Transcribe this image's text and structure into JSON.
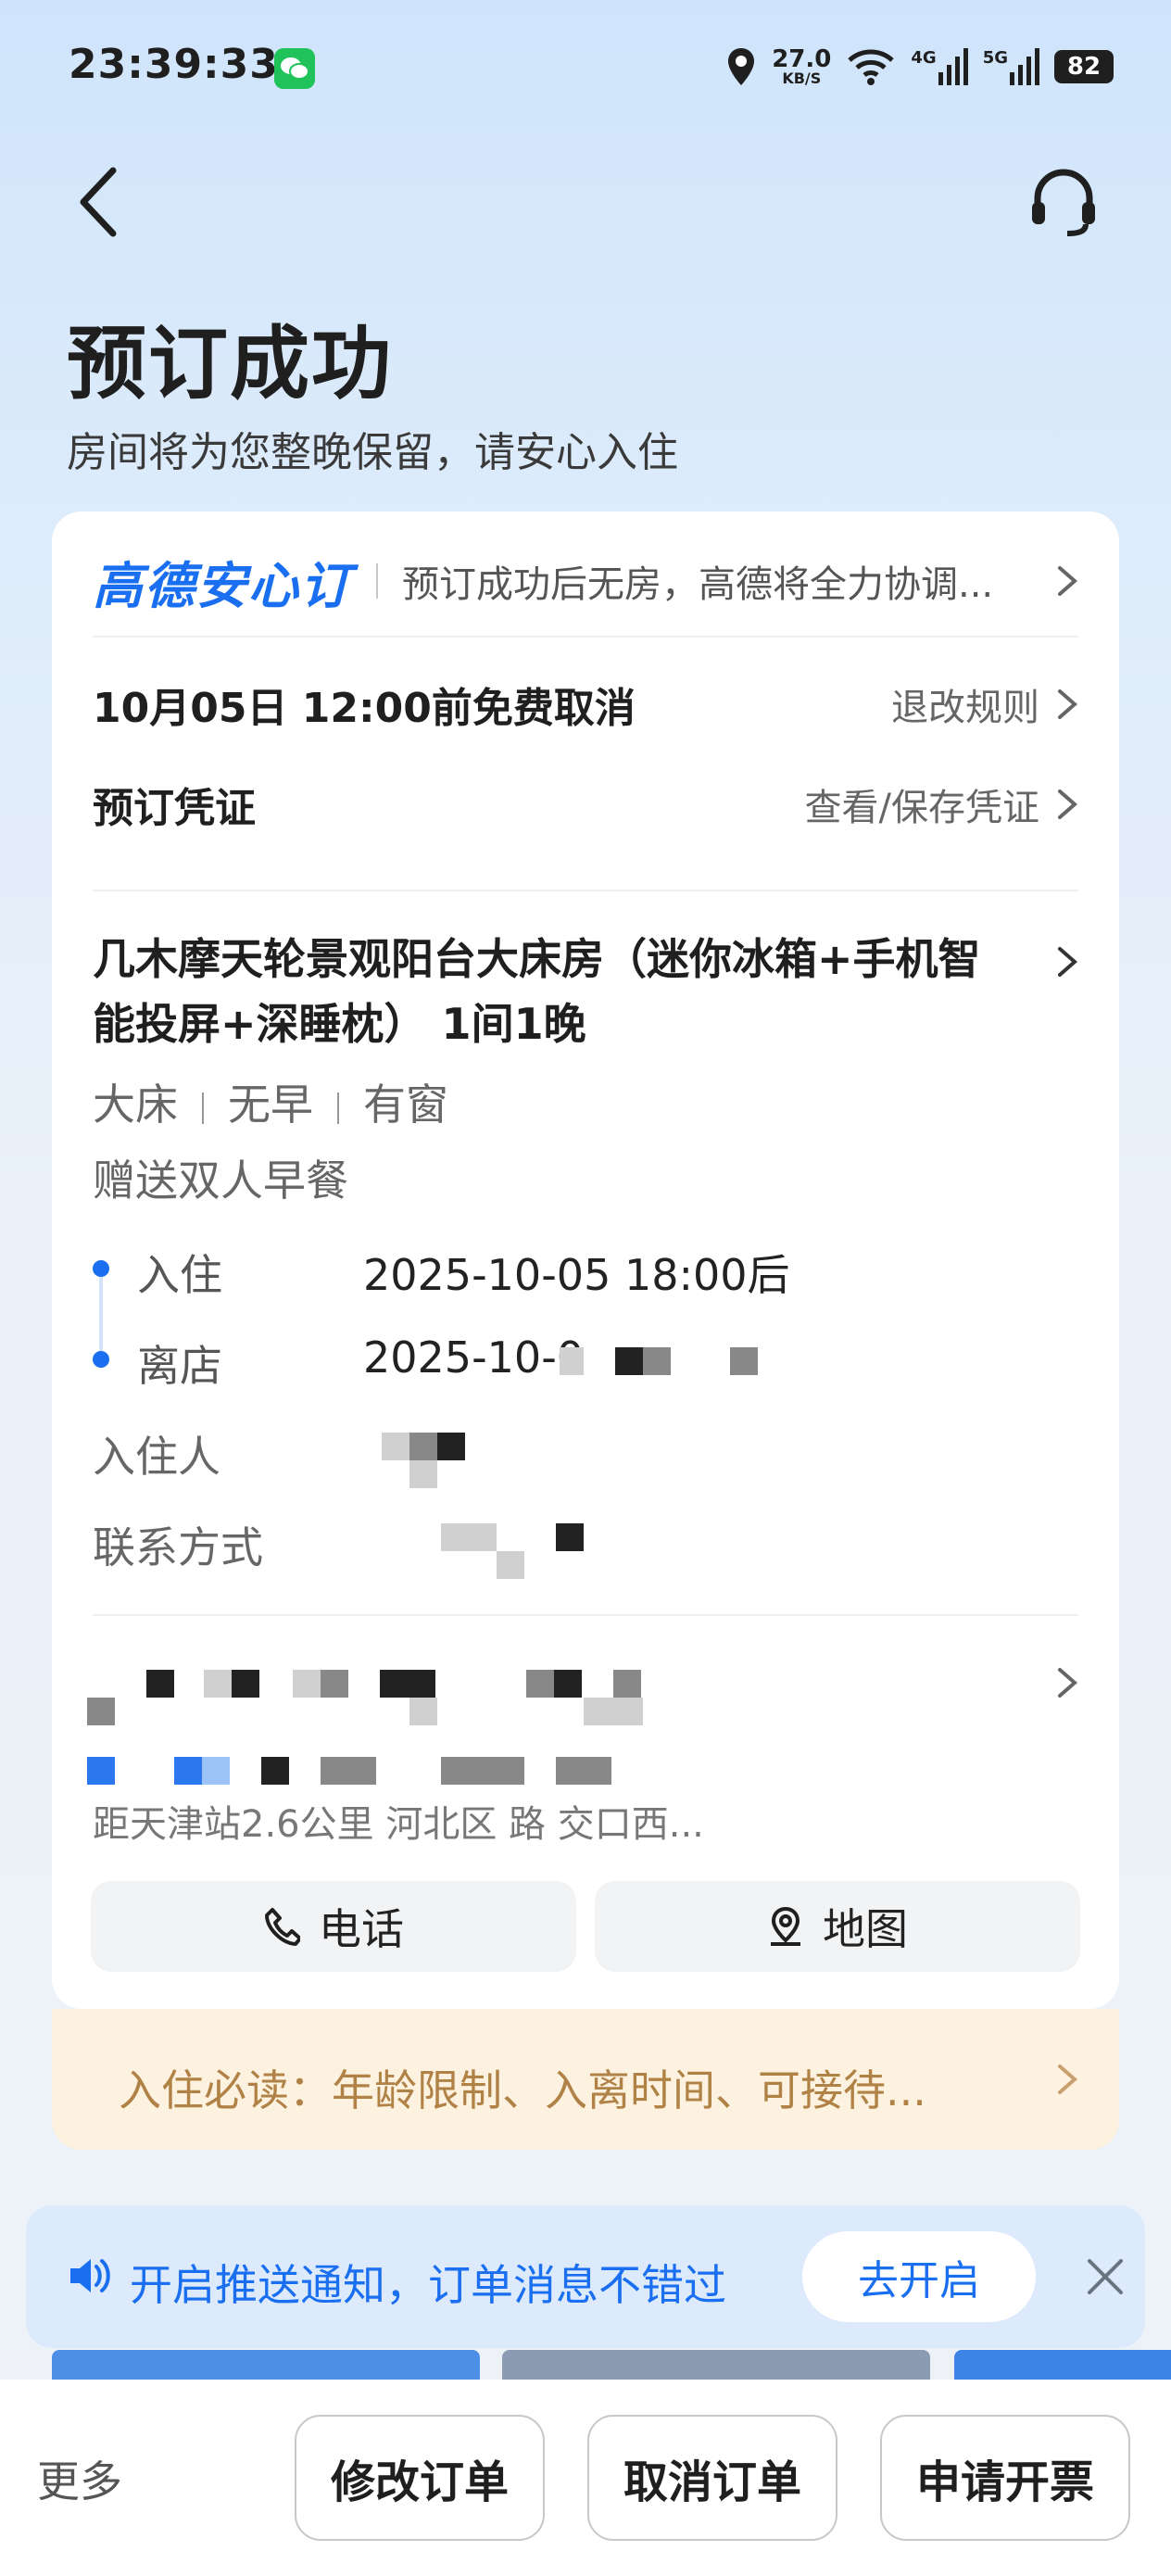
{
  "status_bar": {
    "time": "23:39:33",
    "speed_value": "27.0",
    "speed_unit": "KB/S",
    "net1": "4G",
    "net2": "5G",
    "battery": "82"
  },
  "header": {
    "title": "预订成功",
    "subtitle": "房间将为您整晚保留，请安心入住"
  },
  "guarantee": {
    "brand": "高德安心订",
    "desc": "预订成功后无房，高德将全力协调..."
  },
  "cancel": {
    "label": "10月05日 12:00前免费取消",
    "link": "退改规则"
  },
  "voucher": {
    "label": "预订凭证",
    "link": "查看/保存凭证"
  },
  "room": {
    "name": "几木摩天轮景观阳台大床房（迷你冰箱+手机智能投屏+深睡枕） 1间1晚",
    "tags": [
      "大床",
      "无早",
      "有窗"
    ],
    "gift": "赠送双人早餐"
  },
  "stay": {
    "checkin_label": "入住",
    "checkin_value": "2025-10-05 18:00后",
    "checkout_label": "离店",
    "checkout_value": "2025-10-0"
  },
  "guest": {
    "guest_label": "入住人",
    "contact_label": "联系方式"
  },
  "hotel": {
    "address": "距天津站2.6公里  河北区 路    交口西..."
  },
  "actions": {
    "phone": "电话",
    "map": "地图"
  },
  "notice": {
    "text": "入住必读：年龄限制、入离时间、可接待..."
  },
  "push": {
    "text": "开启推送通知，订单消息不错过",
    "button": "去开启"
  },
  "bottom_bar": {
    "more": "更多",
    "modify": "修改订单",
    "cancel": "取消订单",
    "invoice": "申请开票"
  },
  "colors": {
    "accent": "#1a6ff0",
    "notice_text": "#b08246",
    "notice_bg": "#fdf1e0"
  }
}
